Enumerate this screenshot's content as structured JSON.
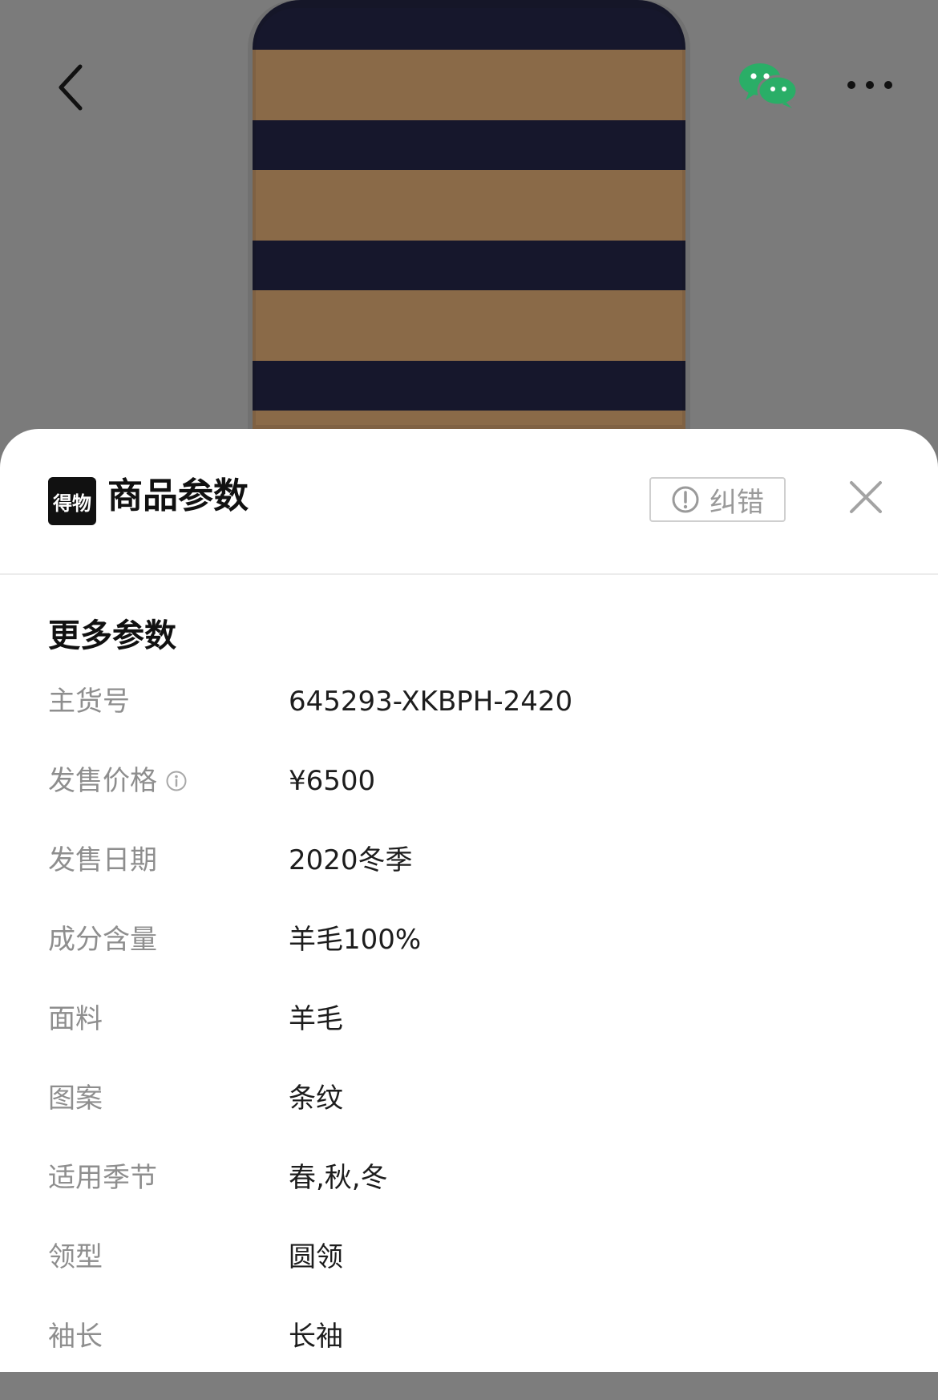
{
  "header": {
    "back_icon": "chevron-left-icon",
    "share_icon": "wechat-icon",
    "more_icon": "more-horizontal-icon"
  },
  "sheet": {
    "logo_text": "得物",
    "title": "商品参数",
    "report_button": "纠错",
    "close_icon": "close-icon",
    "section_title": "更多参数",
    "rows": [
      {
        "label": "主货号",
        "value": "645293-XKBPH-2420"
      },
      {
        "label": "发售价格",
        "value": "¥6500",
        "has_info_icon": true
      },
      {
        "label": "发售日期",
        "value": "2020冬季"
      },
      {
        "label": "成分含量",
        "value": "羊毛100%"
      },
      {
        "label": "面料",
        "value": "羊毛"
      },
      {
        "label": "图案",
        "value": "条纹"
      },
      {
        "label": "适用季节",
        "value": "春,秋,冬"
      },
      {
        "label": "领型",
        "value": "圆领"
      },
      {
        "label": "袖长",
        "value": "长袖"
      }
    ]
  },
  "colors": {
    "wechat_green": "#2aae67",
    "sheet_bg": "#ffffff",
    "label_gray": "#8e8e8e",
    "value_dark": "#1d1d1d"
  }
}
